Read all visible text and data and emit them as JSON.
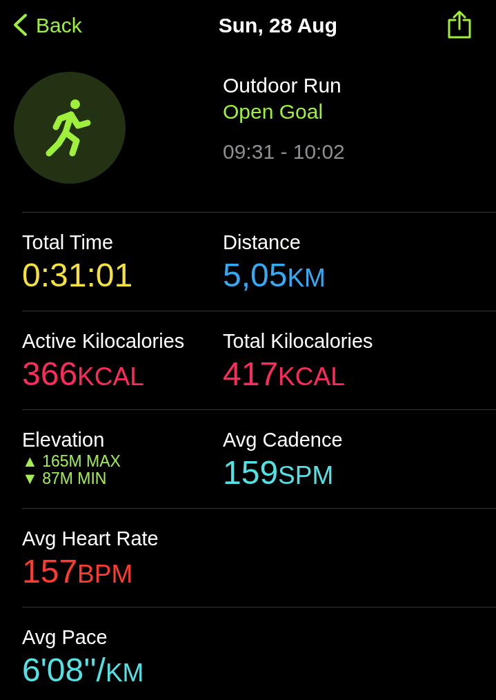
{
  "header": {
    "back": "Back",
    "title": "Sun, 28 Aug"
  },
  "workout": {
    "name": "Outdoor Run",
    "goal": "Open Goal",
    "time_range": "09:31 - 10:02"
  },
  "metric_rows": [
    [
      {
        "kind": "value",
        "label": "Total Time",
        "value": "0:31:01",
        "color": "#f4e13f"
      },
      {
        "kind": "value",
        "label": "Distance",
        "value": "5,05",
        "unit": "KM",
        "color": "#36a9f2"
      }
    ],
    [
      {
        "kind": "value",
        "label": "Active Kilocalories",
        "value": "366",
        "unit": "KCAL",
        "color": "#fa2c5b"
      },
      {
        "kind": "value",
        "label": "Total Kilocalories",
        "value": "417",
        "unit": "KCAL",
        "color": "#fa2c5b"
      }
    ],
    [
      {
        "kind": "elevation",
        "label": "Elevation",
        "lines": [
          "▲ 165M MAX",
          "▼ 87M MIN"
        ],
        "color": "#a3ec55"
      },
      {
        "kind": "value",
        "label": "Avg Cadence",
        "value": "159",
        "unit": "SPM",
        "color": "#55e1e3"
      }
    ],
    [
      {
        "kind": "value",
        "label": "Avg Heart Rate",
        "value": "157",
        "unit": "BPM",
        "color": "#ff3b2f"
      }
    ],
    [
      {
        "kind": "value",
        "label": "Avg Pace",
        "value": "6'08''/",
        "unit": "KM",
        "color": "#55e1e3"
      }
    ]
  ]
}
